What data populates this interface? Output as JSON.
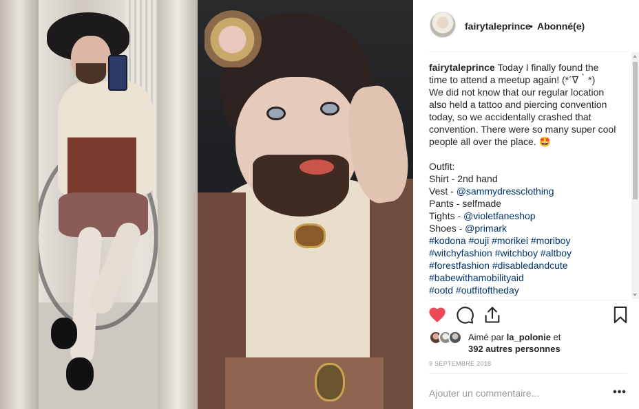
{
  "post": {
    "username": "fairytaleprince",
    "separator": "•",
    "follow_status": "Abonné(e)",
    "caption_lines": [
      {
        "user": "fairytaleprince",
        "text": " Today I finally found the"
      },
      {
        "text": "time to attend a meetup again! (*´∇｀*)"
      },
      {
        "text": "We did not know that our regular location"
      },
      {
        "text": "also held a tattoo and piercing convention"
      },
      {
        "text": "today, so we accidentally crashed that"
      },
      {
        "text": "convention. There were so many super cool"
      },
      {
        "text": "people all over the place. 🤩"
      },
      {
        "text": ""
      },
      {
        "text": "Outfit:"
      },
      {
        "text": "Shirt - 2nd hand"
      },
      {
        "label": "Vest - ",
        "link": "@sammydressclothing"
      },
      {
        "text": "Pants - selfmade"
      },
      {
        "label": "Tights - ",
        "link": "@violetfaneshop"
      },
      {
        "label": "Shoes - ",
        "link": "@primark"
      },
      {
        "link": "#kodona #ouji #morikei #moriboy"
      },
      {
        "link": "#witchyfashion #witchboy #altboy"
      },
      {
        "link": "#forestfashion #disabledandcute"
      },
      {
        "link": "#babewithamobilityaid"
      },
      {
        "link": "#ootd #outfitoftheday"
      }
    ],
    "likes": {
      "prefix": "Aimé par ",
      "liker": "la_polonie",
      "middle": " et",
      "others": "392 autres personnes"
    },
    "date": "9 SEPTEMBRE 2018",
    "comment_placeholder": "Ajouter un commentaire...",
    "more_label": "•••"
  },
  "icons": {
    "like": "heart-filled-icon",
    "comment": "comment-icon",
    "share": "share-icon",
    "save": "bookmark-icon"
  },
  "colors": {
    "like_red": "#ed4956",
    "link_blue": "#003569",
    "text": "#262626",
    "muted": "#999999"
  }
}
